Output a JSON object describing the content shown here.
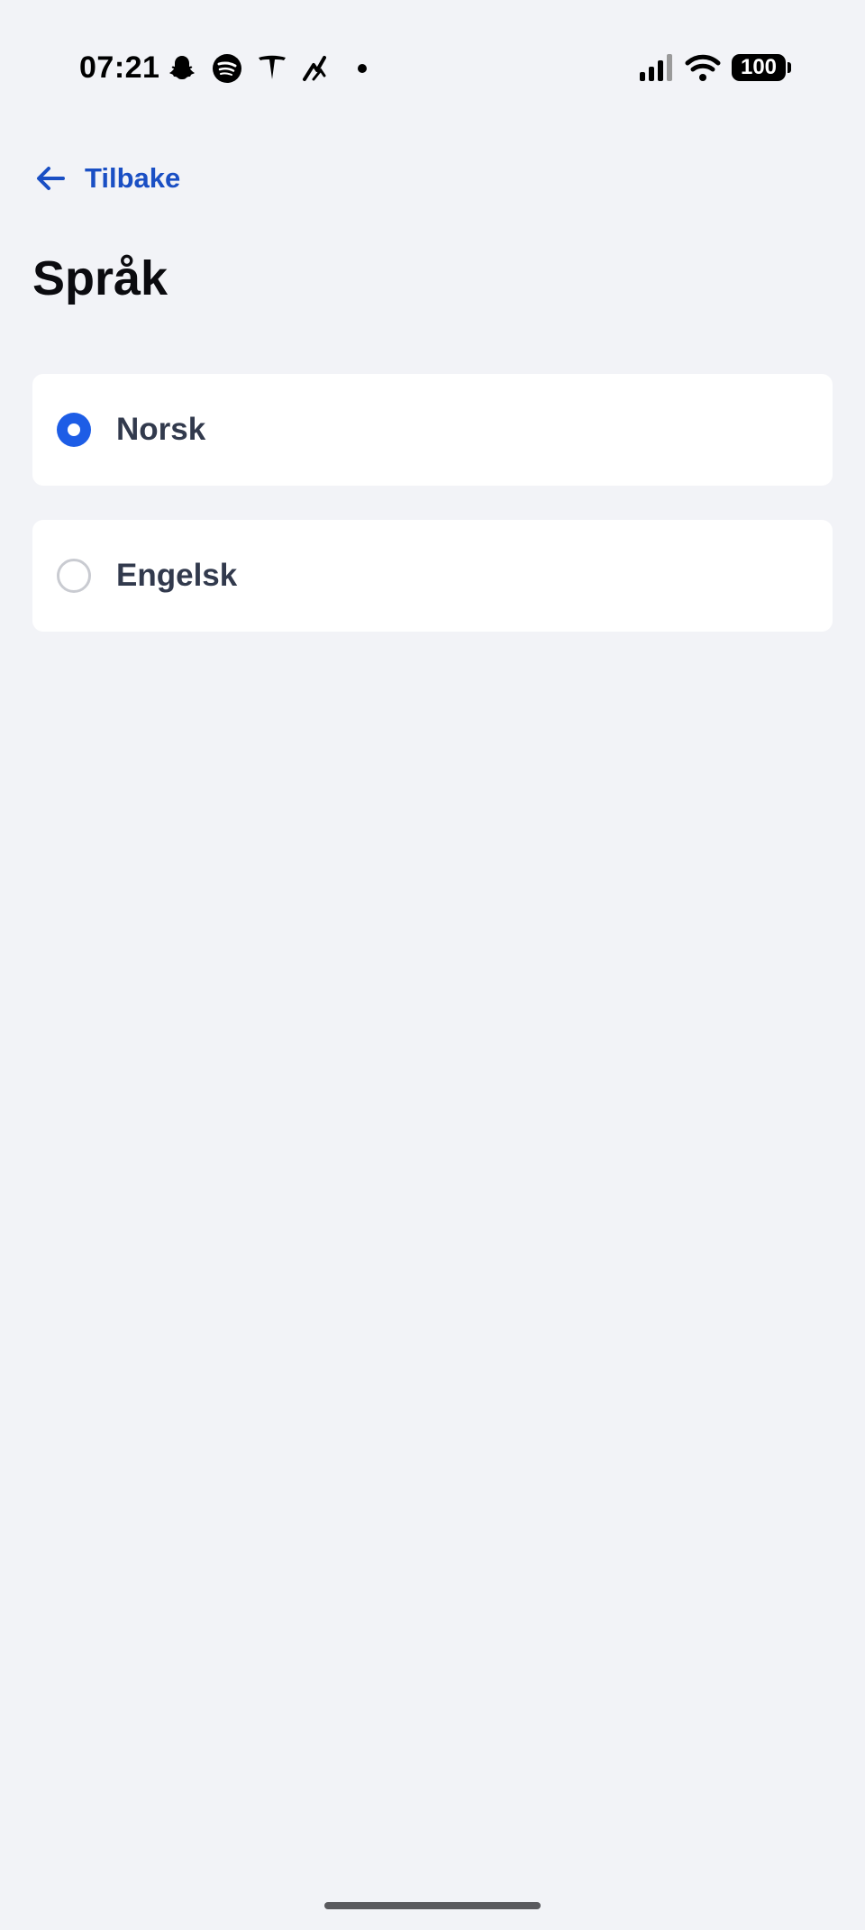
{
  "status_bar": {
    "time": "07:21",
    "notification_icons": [
      "snapchat-icon",
      "spotify-icon",
      "tesla-icon",
      "strava-icon",
      "more-dot-icon"
    ],
    "battery": "100",
    "signal_icon": "cellular-signal-icon",
    "wifi_icon": "wifi-icon"
  },
  "nav": {
    "back_label": "Tilbake",
    "back_icon": "arrow-left-icon"
  },
  "page": {
    "title": "Språk"
  },
  "language_options": [
    {
      "label": "Norsk",
      "selected": true
    },
    {
      "label": "Engelsk",
      "selected": false
    }
  ],
  "colors": {
    "accent": "#1d5de6",
    "link": "#1a4fc4",
    "background": "#f2f3f7",
    "card": "#ffffff",
    "option_text": "#323a4d"
  }
}
